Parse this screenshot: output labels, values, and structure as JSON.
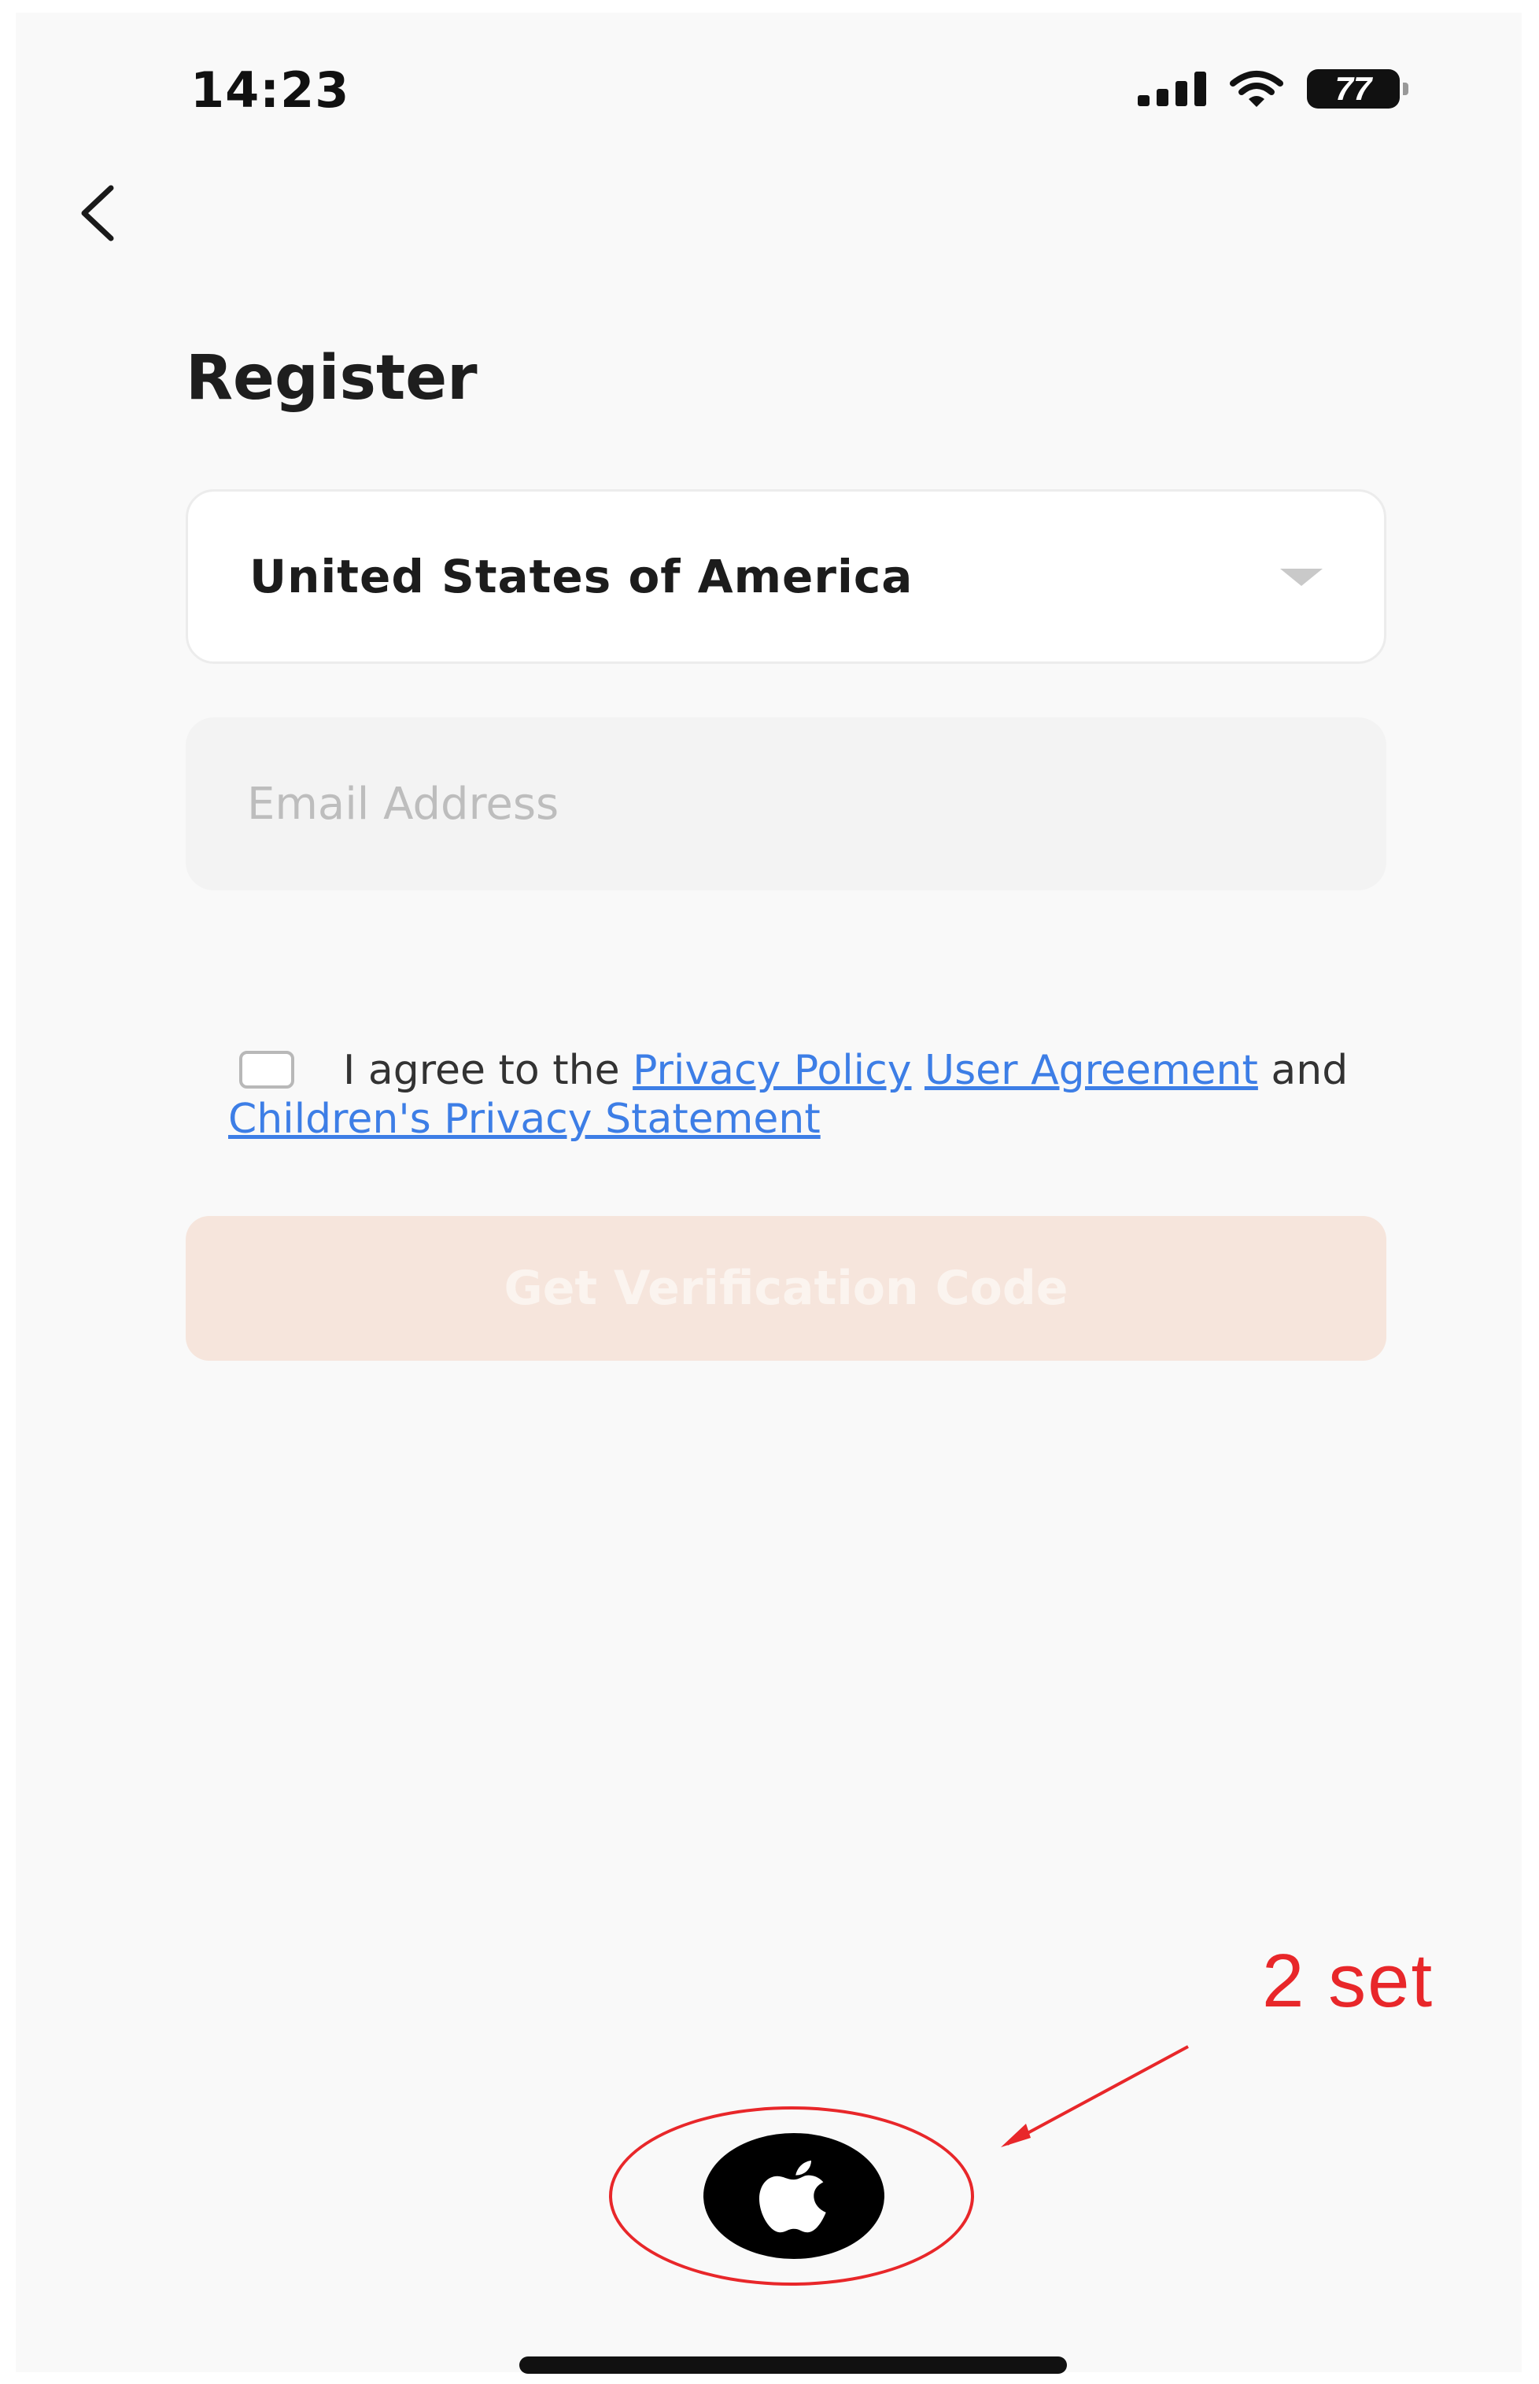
{
  "status_bar": {
    "time": "14:23",
    "battery": "77",
    "icons": [
      "signal-icon",
      "wifi-icon",
      "battery-icon"
    ]
  },
  "nav": {
    "back_icon": "chevron-left-icon"
  },
  "page": {
    "title": "Register"
  },
  "country_select": {
    "value": "United States of America",
    "icon": "dropdown-caret-icon"
  },
  "email": {
    "value": "",
    "placeholder": "Email Address"
  },
  "agreement": {
    "prefix": "I agree to the",
    "privacy_policy": "Privacy Policy",
    "user_agreement": "User Agreement",
    "and": "and",
    "children_privacy": "Children's Privacy Statement",
    "checked": false
  },
  "buttons": {
    "verify_label": "Get Verification Code",
    "apple_icon": "apple-icon"
  },
  "annotation": {
    "label": "2 set",
    "color": "#e8272a"
  },
  "colors": {
    "link": "#3d7ee6",
    "button_disabled_bg": "#f6e5dc",
    "background": "#f9f9f9"
  }
}
